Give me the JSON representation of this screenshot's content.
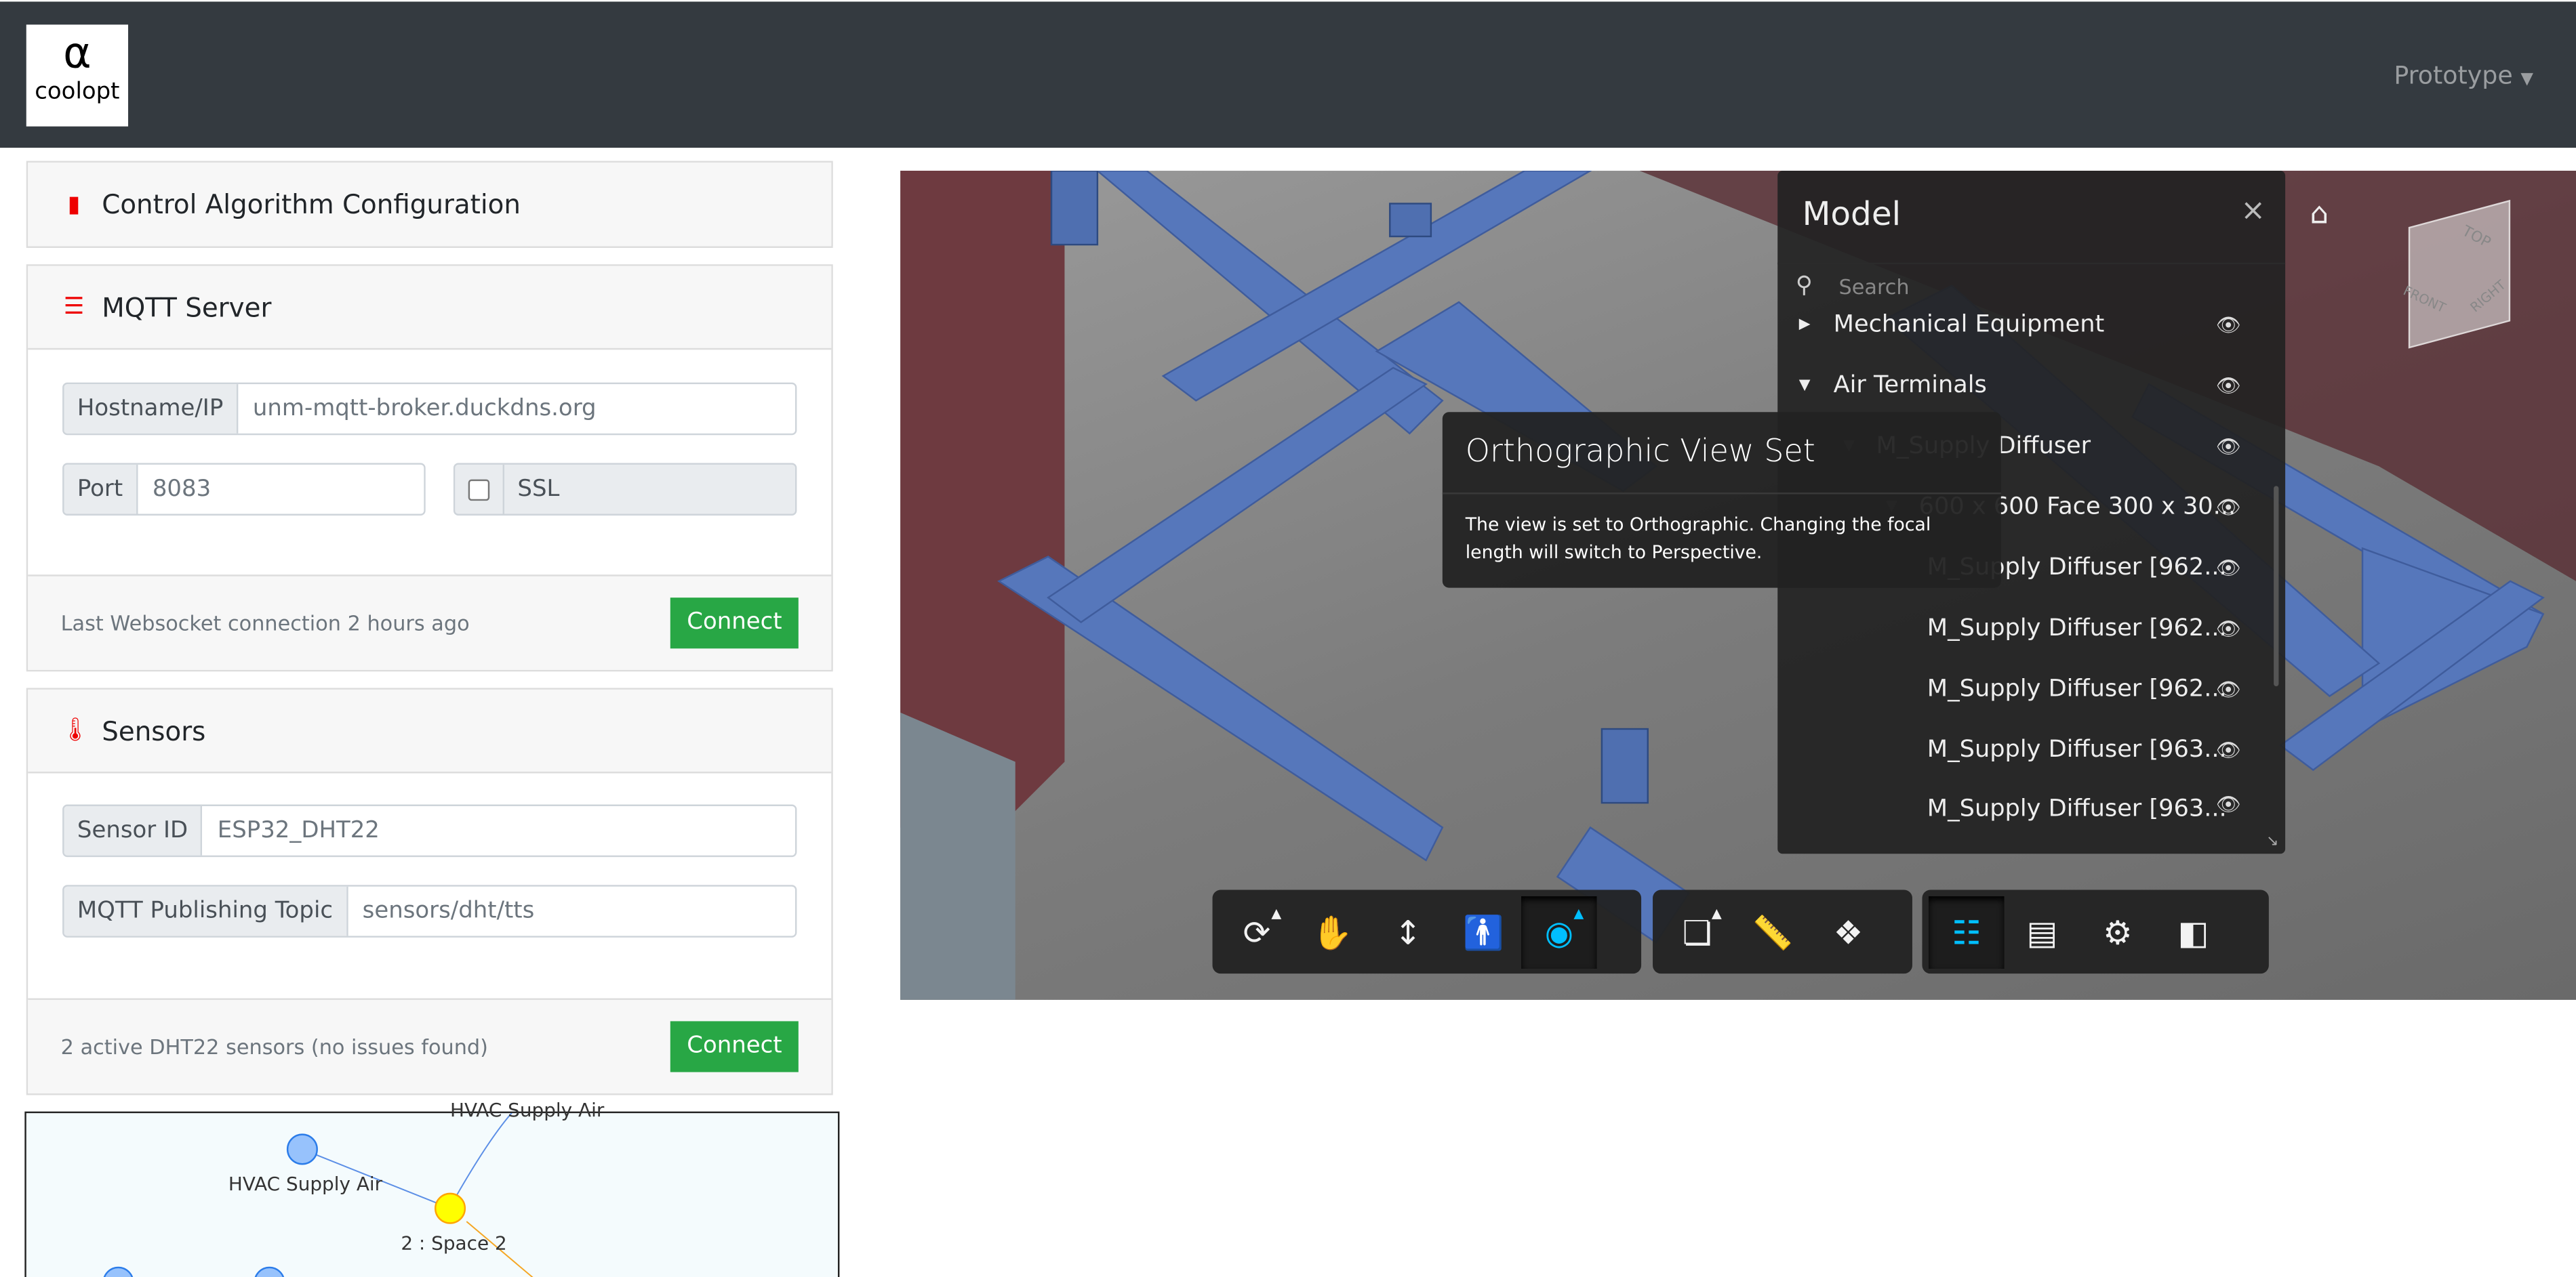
{
  "navbar": {
    "logo_text": "coolopt",
    "menu_label": "Prototype"
  },
  "cards": {
    "control": {
      "title": "Control Algorithm Configuration",
      "icon": "microchip-icon"
    },
    "mqtt": {
      "title": "MQTT Server",
      "icon": "server-icon",
      "hostname_label": "Hostname/IP",
      "hostname_value": "unm-mqtt-broker.duckdns.org",
      "port_label": "Port",
      "port_value": "8083",
      "ssl_label": "SSL",
      "ssl_checked": false,
      "status": "Last Websocket connection 2 hours ago",
      "button": "Connect"
    },
    "sensors": {
      "title": "Sensors",
      "icon": "thermometer-icon",
      "sensor_id_label": "Sensor ID",
      "sensor_id_value": "ESP32_DHT22",
      "topic_label": "MQTT Publishing Topic",
      "topic_value": "sensors/dht/tts",
      "status": "2 active DHT22 sensors (no issues found)",
      "button": "Connect"
    }
  },
  "graph": {
    "nodes": [
      "HVAC Supply Air",
      "2 : Space 2",
      "HVAC Supply Air"
    ]
  },
  "model_panel": {
    "title": "Model",
    "search_placeholder": "Search",
    "items": [
      {
        "label": "Mechanical Equipment",
        "expanded": false
      },
      {
        "label": "Air Terminals",
        "expanded": true
      },
      {
        "label": "M_Supply Diffuser",
        "expanded": true
      },
      {
        "label": "600 x 600 Face 300 x 30...",
        "expanded": true
      },
      {
        "label": "M_Supply Diffuser [962..."
      },
      {
        "label": "M_Supply Diffuser [962..."
      },
      {
        "label": "M_Supply Diffuser [962..."
      },
      {
        "label": "M_Supply Diffuser [963..."
      },
      {
        "label": "M_Supply Diffuser [963..."
      }
    ]
  },
  "tooltip": {
    "title": "Orthographic View Set",
    "body": "The view is set to Orthographic. Changing the focal length will switch to Perspective."
  },
  "viewcube": {
    "top": "TOP",
    "front": "FRONT",
    "right": "RIGHT"
  },
  "colors": {
    "navbar": "#343a40",
    "accent_red": "#e00000",
    "connect_green": "#28a745",
    "viewer_active": "#00bfff",
    "duct_blue": "#4f6fb0"
  }
}
